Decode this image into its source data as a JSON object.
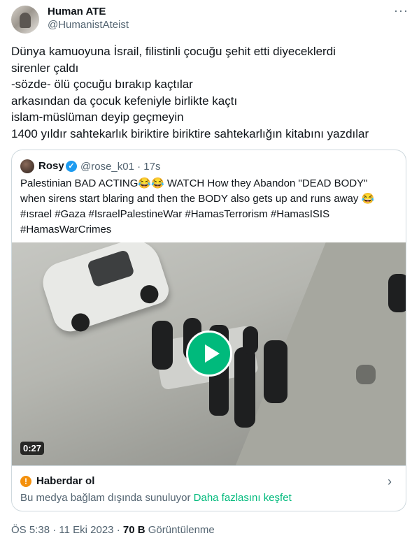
{
  "author": {
    "name": "Human ATE",
    "handle": "@HumanistAteist"
  },
  "tweet": {
    "lines": [
      "Dünya kamuoyuna İsrail, filistinli çocuğu şehit etti diyeceklerdi",
      "sirenler çaldı",
      "-sözde- ölü çocuğu bırakıp kaçtılar",
      "arkasından da çocuk kefeniyle birlikte kaçtı",
      "islam-müslüman deyip geçmeyin",
      "1400 yıldır sahtekarlık biriktire biriktire sahtekarlığın kitabını yazdılar"
    ]
  },
  "quoted": {
    "name": "Rosy",
    "verified_mark": "✓",
    "handle": "@rose_k01",
    "dot": "·",
    "time": "17s",
    "lines": [
      "Palestinian BAD ACTING😂😂  WATCH How they Abandon \"DEAD BODY\"",
      "when sirens start blaring and then the BODY also gets up and runs away 😂"
    ],
    "hashtags_line1": "#ısrael #Gaza #IsraelPalestineWar #HamasTerrorism #HamasISIS",
    "hashtags_line2": "#HamasWarCrimes",
    "video": {
      "duration": "0:27",
      "play_icon": "play-icon"
    },
    "notice": {
      "icon": "warning-icon",
      "title": "Haberdar ol",
      "description": "Bu medya bağlam dışında sunuluyor",
      "link": "Daha fazlasını keşfet"
    }
  },
  "footer": {
    "time": "ÖS 5:38",
    "date": "11 Eki 2023",
    "views_count": "70 B",
    "views_label": "Görüntülenme",
    "separator": "·"
  },
  "colors": {
    "accent": "#00ba7c",
    "text": "#0f1419",
    "secondary": "#536471",
    "verified": "#1d9bf0",
    "warning": "#f4900c"
  }
}
